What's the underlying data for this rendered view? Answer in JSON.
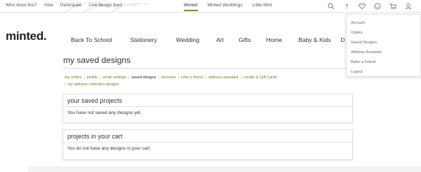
{
  "topbar": {
    "utility_links": [
      "Who drew this?",
      "Vote",
      "Participate",
      "Live design feed"
    ],
    "brand_links": [
      {
        "label": "Minted",
        "active": true
      },
      {
        "label": "Minted Weddings",
        "active": false
      },
      {
        "label": "Little Mint",
        "active": false
      }
    ],
    "icons": [
      "search-icon",
      "help-icon",
      "heart-icon",
      "account-circle-icon",
      "cart-icon",
      "user-icon"
    ]
  },
  "logo": "minted.",
  "nav": [
    "Back To School",
    "Stationery",
    "Wedding",
    "Art",
    "Gifts",
    "Home",
    "Baby & Kids",
    "D"
  ],
  "account_menu": [
    "Account",
    "Orders",
    "Saved Designs",
    "Address Assistant",
    "Refer a Friend",
    "Logout"
  ],
  "page": {
    "title": "my saved designs",
    "subnav": [
      {
        "label": "my orders",
        "current": false
      },
      {
        "label": "profile",
        "current": false
      },
      {
        "label": "email settings",
        "current": false
      },
      {
        "label": "saved designs",
        "current": true
      },
      {
        "label": "favorites",
        "current": false
      },
      {
        "label": "refer a friend",
        "current": false
      },
      {
        "label": "address assistant",
        "current": false
      },
      {
        "label": "credits & Gift Cards",
        "current": false
      },
      {
        "label": "my address collection designs",
        "current": false
      }
    ]
  },
  "saved_projects": {
    "heading": "your saved projects",
    "message": "You have not saved any designs yet."
  },
  "cart_projects": {
    "heading": "projects in your cart",
    "message": "You do not have any designs in your cart."
  },
  "colors": {
    "accent_green": "#5a8a1a",
    "active_underline": "#6a9a2a"
  }
}
